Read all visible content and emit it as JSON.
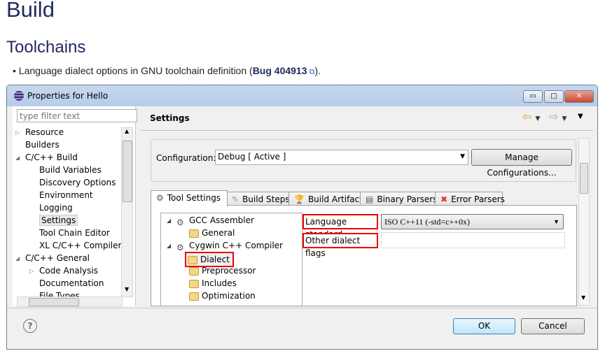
{
  "page": {
    "title": "Build",
    "section": "Toolchains",
    "bullet_text": "Language dialect options in GNU toolchain definition (",
    "bug_link": "Bug 404913",
    "bullet_end": ")."
  },
  "window": {
    "title": "Properties for Hello",
    "minimize": "▭",
    "maximize": "□",
    "close": "✕",
    "filter_placeholder": "type filter text",
    "nav": [
      {
        "label": "Resource",
        "level": 0,
        "expander": "▷"
      },
      {
        "label": "Builders",
        "level": 0,
        "expander": ""
      },
      {
        "label": "C/C++ Build",
        "level": 0,
        "expander": "◢"
      },
      {
        "label": "Build Variables",
        "level": 1
      },
      {
        "label": "Discovery Options",
        "level": 1
      },
      {
        "label": "Environment",
        "level": 1
      },
      {
        "label": "Logging",
        "level": 1
      },
      {
        "label": "Settings",
        "level": 1,
        "selected": true
      },
      {
        "label": "Tool Chain Editor",
        "level": 1
      },
      {
        "label": "XL C/C++ Compiler",
        "level": 1
      },
      {
        "label": "C/C++ General",
        "level": 0,
        "expander": "◢"
      },
      {
        "label": "Code Analysis",
        "level": 1,
        "expander": "▷"
      },
      {
        "label": "Documentation",
        "level": 1
      },
      {
        "label": "File Types",
        "level": 1
      }
    ],
    "settings_title": "Settings",
    "configuration_label": "Configuration:",
    "configuration_value": "Debug  [ Active ]",
    "manage_configurations": "Manage Configurations...",
    "tabs": [
      "Tool Settings",
      "Build Steps",
      "Build Artifact",
      "Binary Parsers",
      "Error Parsers"
    ],
    "active_tab": "Tool Settings",
    "tool_tree": [
      {
        "label": "GCC Assembler",
        "level": 0
      },
      {
        "label": "General",
        "level": 1
      },
      {
        "label": "Cygwin C++ Compiler",
        "level": 0
      },
      {
        "label": "Dialect",
        "level": 1,
        "selected": true
      },
      {
        "label": "Preprocessor",
        "level": 1
      },
      {
        "label": "Includes",
        "level": 1
      },
      {
        "label": "Optimization",
        "level": 1
      }
    ],
    "language_standard_label": "Language standard",
    "language_standard_value": "ISO C++11 (-std=c++0x)",
    "other_flags_label": "Other dialect flags",
    "other_flags_value": "",
    "ok": "OK",
    "cancel": "Cancel",
    "help": "?"
  },
  "colors": {
    "highlight": "#e00000",
    "heading": "#222a5e",
    "titlebar": "#c5d8ee"
  }
}
